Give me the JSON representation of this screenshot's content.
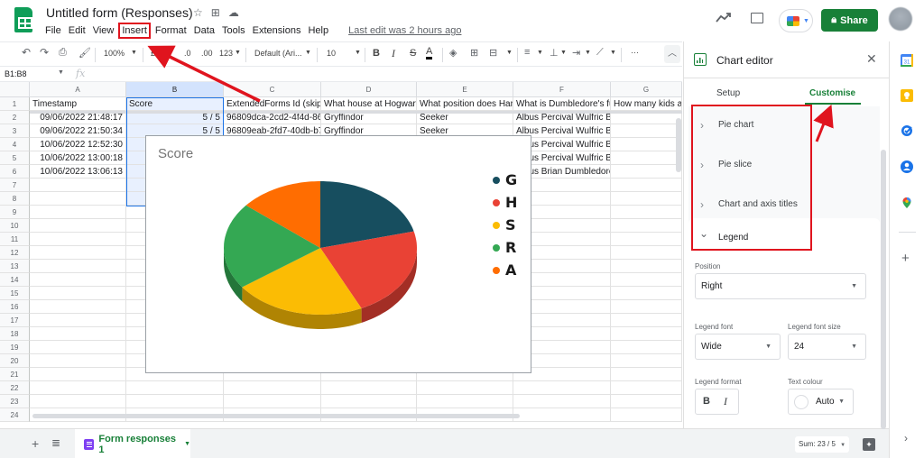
{
  "app": {
    "doc_title": "Untitled form (Responses)",
    "menu": [
      "File",
      "Edit",
      "View",
      "Insert",
      "Format",
      "Data",
      "Tools",
      "Extensions",
      "Help"
    ],
    "last_edit": "Last edit was 2 hours ago",
    "share_label": "Share"
  },
  "toolbar": {
    "zoom": "100%",
    "currency": "£",
    "decrease_decimals": ".0",
    "increase_decimals": ".00",
    "more_formats": "123",
    "font": "Default (Ari...",
    "font_size": "10",
    "bold": "B",
    "italic": "I",
    "strikethrough": "S",
    "text_color": "A",
    "more": "···"
  },
  "formula_bar": {
    "name_box": "B1:B8",
    "fx": "fx"
  },
  "sheet": {
    "columns": [
      "A",
      "B",
      "C",
      "D",
      "E",
      "F",
      "G"
    ],
    "row_numbers": [
      "1",
      "2",
      "3",
      "4",
      "5",
      "6",
      "7",
      "8",
      "9",
      "10",
      "11",
      "12",
      "13",
      "14",
      "15",
      "16",
      "17",
      "18",
      "19",
      "20",
      "21",
      "22",
      "23",
      "24"
    ],
    "header_row": [
      "Timestamp",
      "Score",
      "ExtendedForms Id (skip t",
      "What house at Hogwarts",
      "What position does Harry",
      "What is Dumbledore's ful",
      "How many kids a"
    ],
    "rows": [
      [
        "09/06/2022 21:48:17",
        "5 / 5",
        "96809dca-2cd2-4f4d-86t",
        "Gryffindor",
        "Seeker",
        "Albus Percival Wulfric Bri",
        ""
      ],
      [
        "09/06/2022 21:50:34",
        "5 / 5",
        "96809eab-2fd7-40db-b7:",
        "Gryffindor",
        "Seeker",
        "Albus Percival Wulfric Bri",
        ""
      ],
      [
        "10/06/2022 12:52:30",
        "",
        "",
        "",
        "",
        "Albus Percival Wulfric Bri",
        ""
      ],
      [
        "10/06/2022 13:00:18",
        "",
        "",
        "",
        "",
        "Albus Percival Wulfric Bri",
        ""
      ],
      [
        "10/06/2022 13:06:13",
        "",
        "",
        "",
        "",
        "Albus Brian Dumbledore",
        ""
      ]
    ]
  },
  "chart_data": {
    "type": "pie",
    "style": "3d",
    "title": "Score",
    "categories": [
      "G",
      "H",
      "S",
      "R",
      "A"
    ],
    "values": [
      21,
      22,
      22,
      21,
      14
    ],
    "value_unit": "percent (estimated from slice angles)",
    "colors": [
      "#174e5f",
      "#e94235",
      "#fbbc04",
      "#34a853",
      "#ff6d01"
    ],
    "legend_position": "right"
  },
  "bottom_bar": {
    "sheet_tab": "Form responses 1",
    "sum": "Sum: 23 / 5"
  },
  "chart_editor": {
    "title": "Chart editor",
    "tabs": [
      "Setup",
      "Customise"
    ],
    "active_tab": "Customise",
    "sections": [
      "Pie chart",
      "Pie slice",
      "Chart and axis titles",
      "Legend"
    ],
    "expanded_section": "Legend",
    "legend": {
      "position_label": "Position",
      "position_value": "Right",
      "font_label": "Legend font",
      "font_value": "Wide",
      "font_size_label": "Legend font size",
      "font_size_value": "24",
      "format_label": "Legend format",
      "format_bold": "B",
      "format_italic": "I",
      "text_colour_label": "Text colour",
      "text_colour_value": "Auto"
    }
  },
  "colors": {
    "brand_green": "#188038",
    "selection_blue": "#1a73e8",
    "annotation_red": "#e0141e"
  }
}
